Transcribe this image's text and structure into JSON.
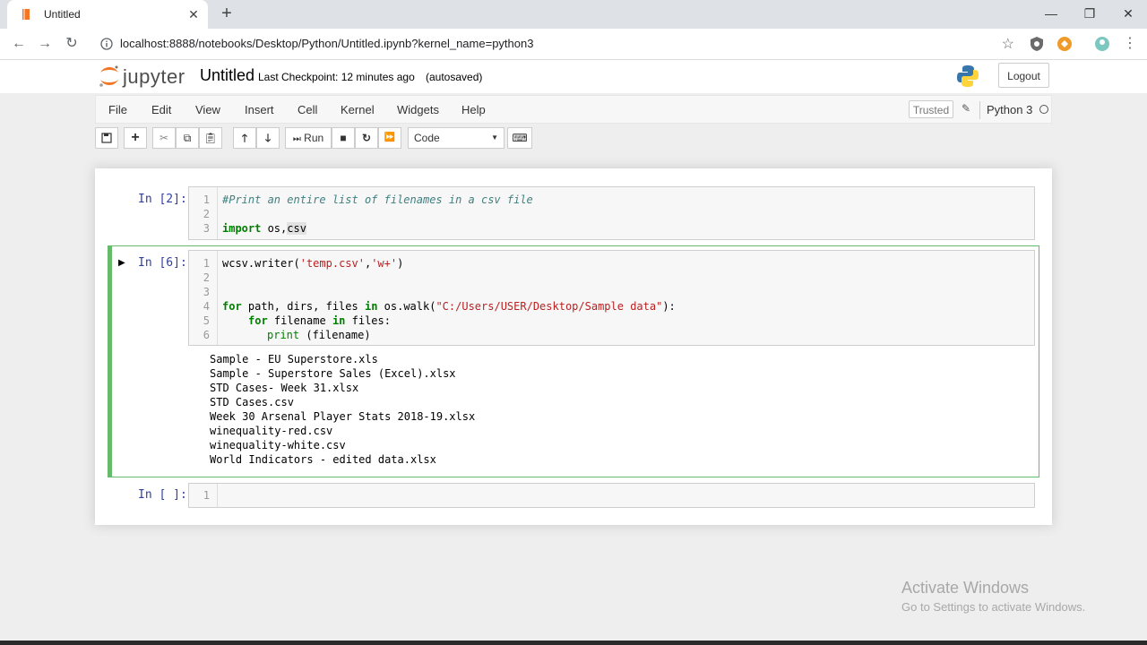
{
  "browser": {
    "tab_title": "Untitled",
    "url": "localhost:8888/notebooks/Desktop/Python/Untitled.ipynb?kernel_name=python3"
  },
  "jupyter": {
    "logo_text": "jupyter",
    "notebook_name": "Untitled",
    "checkpoint": "Last Checkpoint: 12 minutes ago",
    "autosave": "(autosaved)",
    "logout_label": "Logout"
  },
  "menubar": {
    "items": [
      "File",
      "Edit",
      "View",
      "Insert",
      "Cell",
      "Kernel",
      "Widgets",
      "Help"
    ],
    "trusted": "Trusted",
    "kernel": "Python 3"
  },
  "toolbar": {
    "run_label": "Run",
    "cell_type": "Code"
  },
  "cells": [
    {
      "prompt": "In [2]:",
      "line_numbers": [
        "1",
        "2",
        "3"
      ],
      "lines": {
        "l1": "#Print an entire list of filenames in a csv file",
        "l2": "",
        "l3_kw": "import",
        "l3_rest": " os,",
        "l3_hl": "csv"
      }
    },
    {
      "prompt": "In [6]:",
      "line_numbers": [
        "1",
        "2",
        "3",
        "4",
        "5",
        "6"
      ],
      "lines": {
        "l1a": "w",
        "l1b": "csv.writer(",
        "l1c": "'temp.csv'",
        "l1d": ",",
        "l1e": "'w+'",
        "l1f": ")",
        "l4_kw1": "for",
        "l4_mid": " path, dirs, files ",
        "l4_kw2": "in",
        "l4_mid2": " os.walk(",
        "l4_str": "\"C:/Users/USER/Desktop/Sample data\"",
        "l4_end": "):",
        "l5_kw1": "for",
        "l5_mid": " filename ",
        "l5_kw2": "in",
        "l5_end": " files:",
        "l6_kw": "print",
        "l6_end": " (filename)"
      },
      "output": [
        "Sample - EU Superstore.xls",
        "Sample - Superstore Sales (Excel).xlsx",
        "STD Cases- Week 31.xlsx",
        "STD Cases.csv",
        "Week 30 Arsenal Player Stats 2018-19.xlsx",
        "winequality-red.csv",
        "winequality-white.csv",
        "World Indicators - edited data.xlsx"
      ]
    },
    {
      "prompt": "In [ ]:",
      "line_numbers": [
        "1"
      ]
    }
  ],
  "watermark": {
    "title": "Activate Windows",
    "subtitle": "Go to Settings to activate Windows."
  }
}
